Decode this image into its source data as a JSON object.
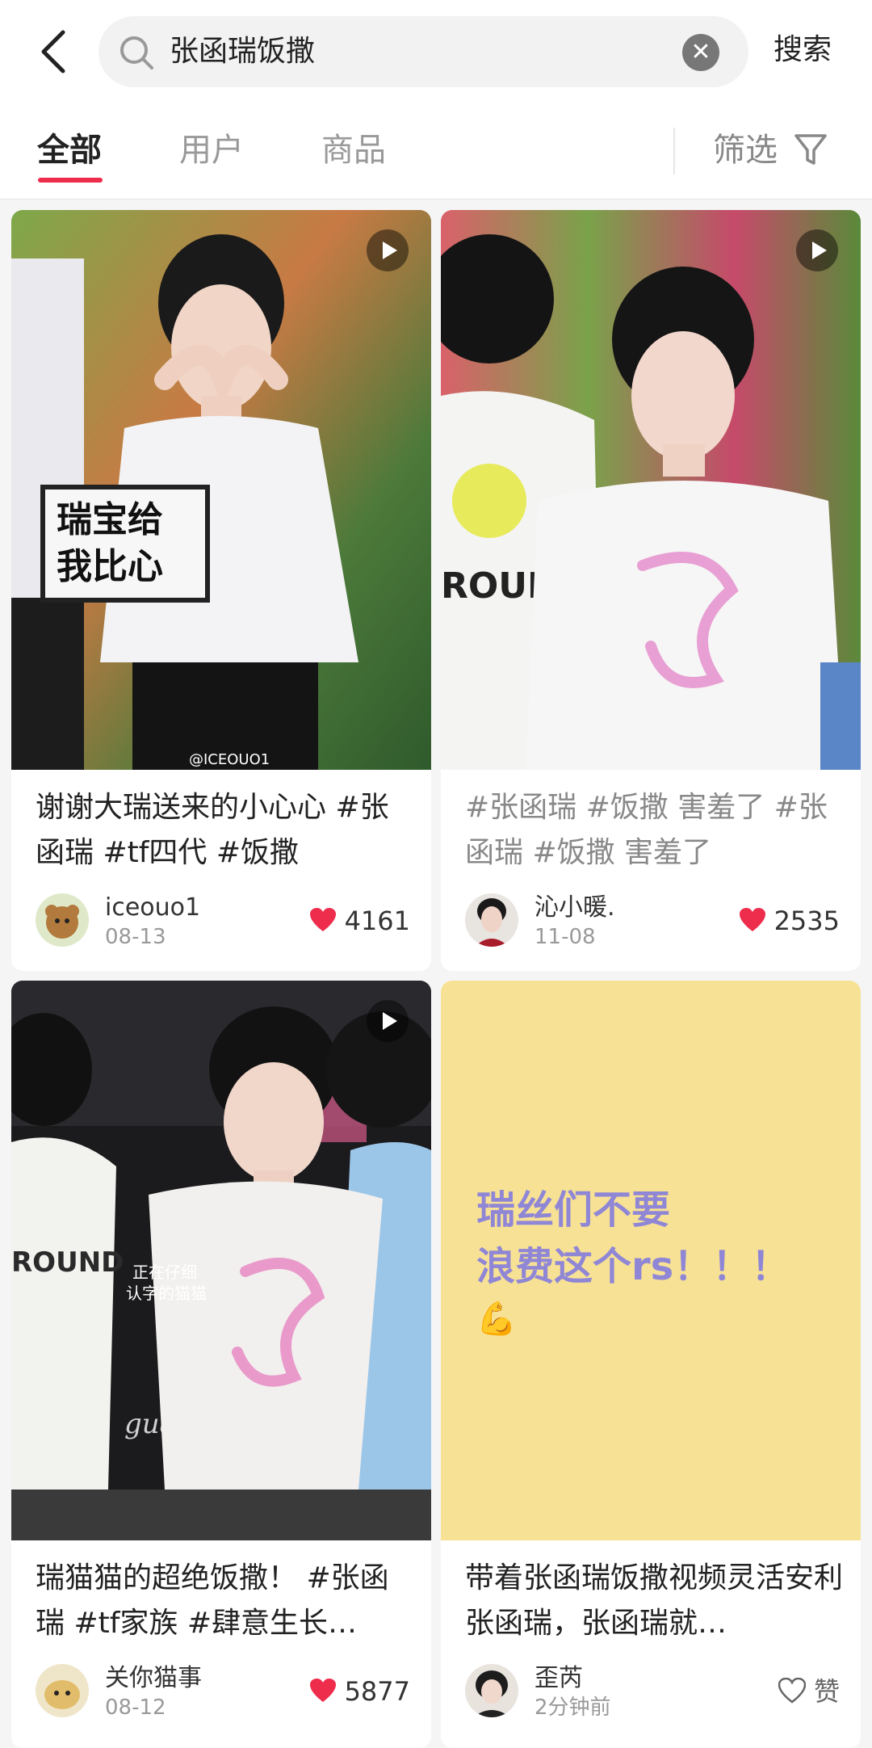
{
  "header": {
    "search_query": "张函瑞饭撒",
    "search_button": "搜索",
    "clear_label": "✕"
  },
  "tabs": [
    {
      "label": "全部",
      "active": true
    },
    {
      "label": "用户",
      "active": false
    },
    {
      "label": "商品",
      "active": false
    }
  ],
  "filter": {
    "label": "筛选"
  },
  "accent_color": "#ee2c4c",
  "cards": [
    {
      "caption": "谢谢大瑞送来的小心心 #张函瑞 #tf四代 #饭撒",
      "image_overlay_text": "瑞宝给我比心",
      "watermark": "@ICEOUO1",
      "user": "iceouo1",
      "date": "08-13",
      "likes": "4161",
      "liked": true,
      "is_video": true
    },
    {
      "caption": "#张函瑞 #饭撒 害羞了 #张函瑞 #饭撒 害羞了",
      "image_overlay_text": "ROUND",
      "user": "沁小暖.",
      "date": "11-08",
      "likes": "2535",
      "liked": true,
      "is_video": true
    },
    {
      "caption": "瑞猫猫的超绝饭撒！ #张函瑞 #tf家族 #肆意生长…",
      "image_overlay_text": "正在仔细认字的猫猫",
      "watermark": "guannimaoshi",
      "image_print_text": "ROUND",
      "user": "关你猫事",
      "date": "08-12",
      "likes": "5877",
      "liked": true,
      "is_video": true
    },
    {
      "caption": "带着张函瑞饭撒视频灵活安利张函瑞，张函瑞就…",
      "image_text_line1": "瑞丝们不要",
      "image_text_line2": "浪费这个rs！！！",
      "user": "歪芮",
      "date": "2分钟前",
      "likes": "赞",
      "liked": false,
      "is_video": false
    }
  ]
}
